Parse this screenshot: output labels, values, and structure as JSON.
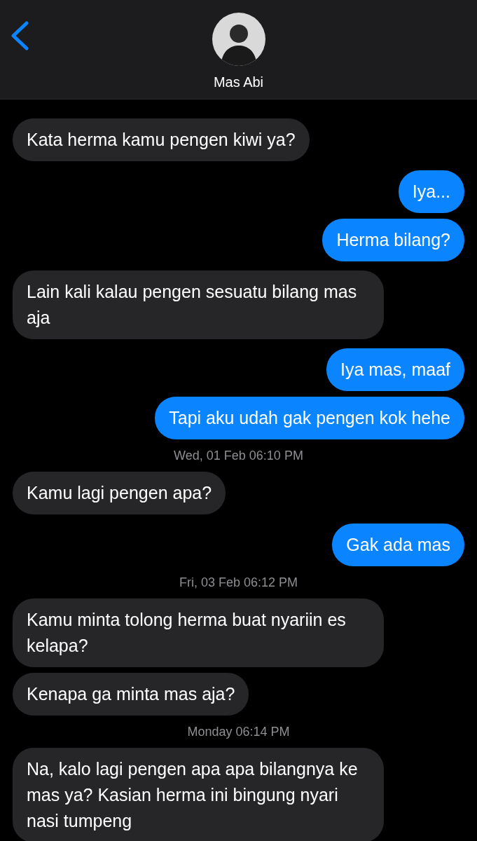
{
  "header": {
    "contact_name": "Mas Abi"
  },
  "messages": [
    {
      "kind": "incoming",
      "text": "Kata herma kamu pengen kiwi ya?"
    },
    {
      "kind": "outgoing",
      "text": "Iya..."
    },
    {
      "kind": "outgoing",
      "text": "Herma bilang?"
    },
    {
      "kind": "incoming",
      "text": "Lain kali kalau pengen sesuatu bilang mas aja"
    },
    {
      "kind": "outgoing",
      "text": "Iya mas, maaf"
    },
    {
      "kind": "outgoing",
      "text": "Tapi aku udah gak pengen kok hehe"
    },
    {
      "kind": "timestamp",
      "text": "Wed, 01 Feb 06:10 PM"
    },
    {
      "kind": "incoming",
      "text": "Kamu lagi pengen apa?"
    },
    {
      "kind": "outgoing",
      "text": "Gak ada mas"
    },
    {
      "kind": "timestamp",
      "text": "Fri, 03 Feb 06:12 PM"
    },
    {
      "kind": "incoming",
      "text": "Kamu minta tolong herma buat nyariin es kelapa?"
    },
    {
      "kind": "incoming",
      "text": "Kenapa ga minta mas aja?"
    },
    {
      "kind": "timestamp",
      "text": "Monday 06:14 PM"
    },
    {
      "kind": "incoming",
      "text": "Na, kalo lagi pengen apa apa bilangnya ke mas ya? Kasian herma ini bingung nyari nasi tumpeng"
    }
  ]
}
